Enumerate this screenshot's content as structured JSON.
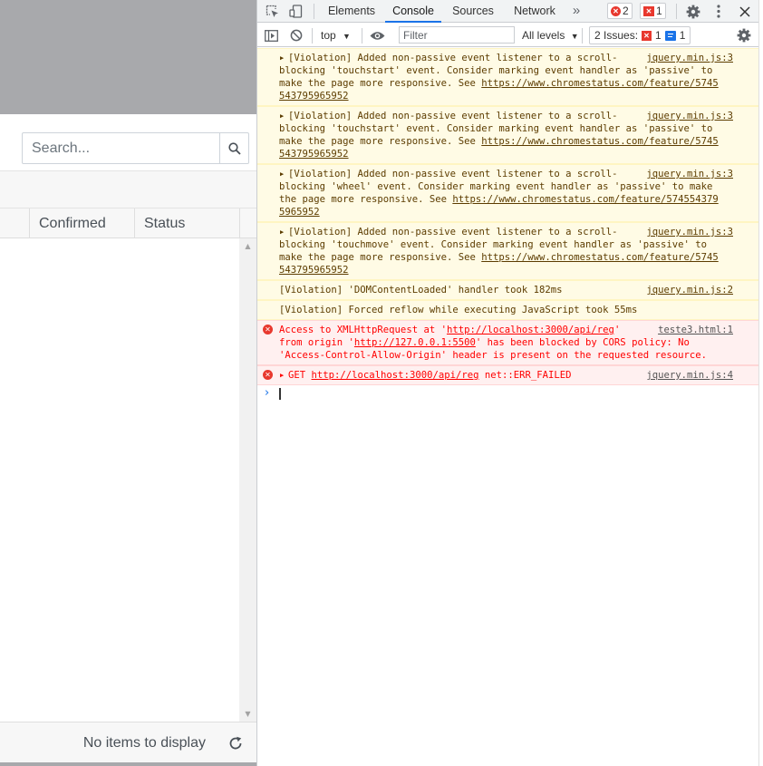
{
  "app": {
    "search_placeholder": "Search...",
    "columns": [
      "Confirmed",
      "Status"
    ],
    "footer_text": "No items to display"
  },
  "devtools": {
    "tabs": [
      "Elements",
      "Console",
      "Sources",
      "Network"
    ],
    "active_tab": "Console",
    "more_tabs": "»",
    "error_count": "2",
    "issue_count": "1",
    "context": "top",
    "filter_placeholder": "Filter",
    "levels": "All levels",
    "issues_label": "2 Issues:",
    "issues_error": "1",
    "issues_info": "1"
  },
  "messages": [
    {
      "type": "warn",
      "lines": [
        "[Violation] Added non-passive event listener to a scroll-",
        "blocking 'touchstart' event. Consider marking event handler as 'passive' to",
        "make the page more responsive. See "
      ],
      "link": "https://www.chromestatus.com/feature/5745",
      "link2": "543795965952",
      "source": "jquery.min.js:3"
    },
    {
      "type": "warn",
      "lines": [
        "[Violation] Added non-passive event listener to a scroll-",
        "blocking 'touchstart' event. Consider marking event handler as 'passive' to",
        "make the page more responsive. See "
      ],
      "link": "https://www.chromestatus.com/feature/5745",
      "link2": "543795965952",
      "source": "jquery.min.js:3"
    },
    {
      "type": "warn",
      "lines": [
        "[Violation] Added non-passive event listener to a scroll-",
        "blocking 'wheel' event. Consider marking event handler as 'passive' to make",
        "the page more responsive. See "
      ],
      "link": "https://www.chromestatus.com/feature/574554379",
      "link2": "5965952",
      "source": "jquery.min.js:3"
    },
    {
      "type": "warn",
      "lines": [
        "[Violation] Added non-passive event listener to a scroll-",
        "blocking 'touchmove' event. Consider marking event handler as 'passive' to",
        "make the page more responsive. See "
      ],
      "link": "https://www.chromestatus.com/feature/5745",
      "link2": "543795965952",
      "source": "jquery.min.js:3"
    },
    {
      "type": "warn",
      "text": "[Violation] 'DOMContentLoaded' handler took 182ms",
      "source": "jquery.min.js:2"
    },
    {
      "type": "warn",
      "text": "[Violation] Forced reflow while executing JavaScript took 55ms",
      "source": ""
    },
    {
      "type": "err",
      "l1_pre": "Access to XMLHttpRequest at '",
      "l1_link": "http://localhost:3000/api/reg",
      "l1_post": "'",
      "l2_pre": "from origin '",
      "l2_link": "http://127.0.0.1:5500",
      "l2_post": "' has been blocked by CORS policy: No",
      "l3": "'Access-Control-Allow-Origin' header is present on the requested resource.",
      "source": "teste3.html:1"
    },
    {
      "type": "err",
      "pre": "GET ",
      "link": "http://localhost:3000/api/reg",
      "post": " net::ERR_FAILED",
      "source": "jquery.min.js:4"
    }
  ],
  "prompt_symbol": "›"
}
